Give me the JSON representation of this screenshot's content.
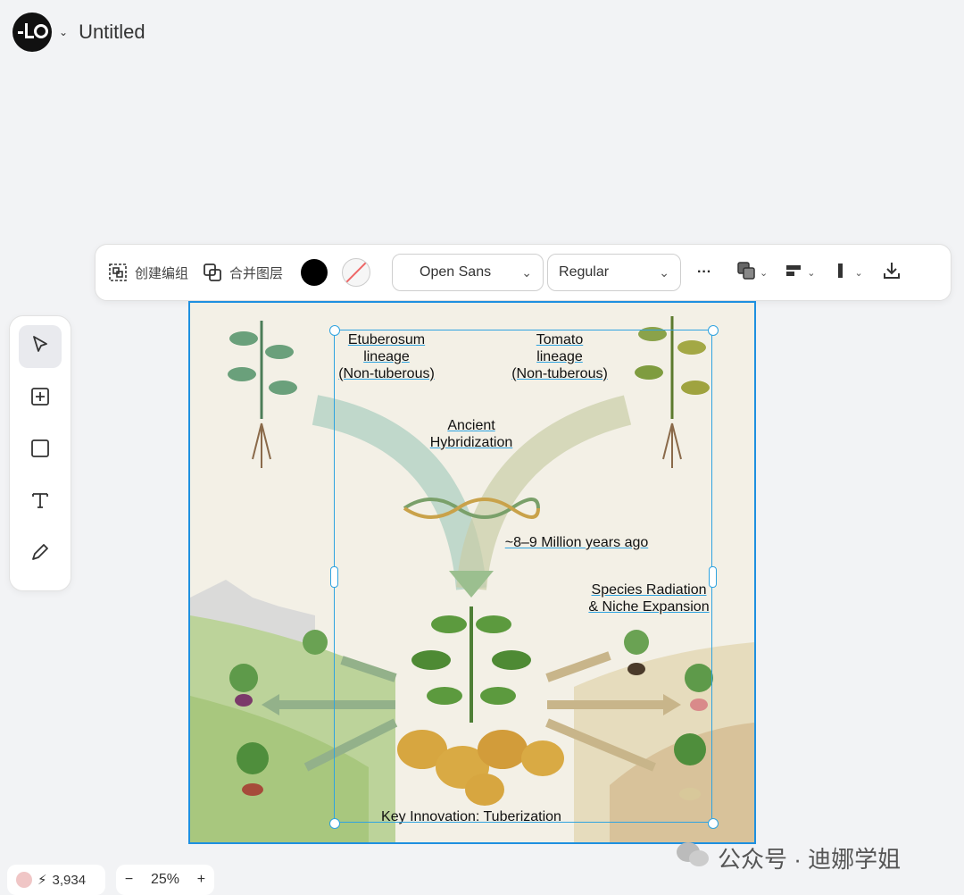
{
  "header": {
    "title": "Untitled"
  },
  "toolbar": {
    "create_group": "创建编组",
    "merge_layers": "合并图层",
    "font_family": "Open Sans",
    "font_weight": "Regular",
    "more": "···",
    "text_color": "#000000"
  },
  "canvas": {
    "labels": {
      "etuberosum": "Etuberosum\nlineage\n(Non-tuberous)",
      "tomato": "Tomato\nlineage\n(Non-tuberous)",
      "hybrid": "Ancient\nHybridization",
      "years": "~8–9 Million years ago",
      "radiation": "Species Radiation\n& Niche Expansion",
      "innovation": "Key Innovation: Tuberization"
    }
  },
  "footer": {
    "credits": "3,934",
    "zoom": "25%",
    "zoom_out": "−",
    "zoom_in": "+"
  },
  "watermark": "公众号 · 迪娜学姐",
  "colors": {
    "selection": "#2fa3e0",
    "frame": "#1e90e0"
  }
}
